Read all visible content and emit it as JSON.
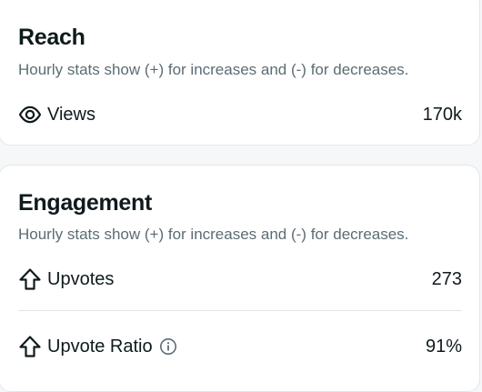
{
  "reach": {
    "title": "Reach",
    "subtitle": "Hourly stats show (+) for increases and (-) for decreases.",
    "views": {
      "icon": "eye-icon",
      "label": "Views",
      "value": "170k"
    }
  },
  "engagement": {
    "title": "Engagement",
    "subtitle": "Hourly stats show (+) for increases and (-) for decreases.",
    "upvotes": {
      "icon": "upvote-arrow-icon",
      "label": "Upvotes",
      "value": "273"
    },
    "upvote_ratio": {
      "icon": "upvote-arrow-icon",
      "label": "Upvote Ratio",
      "info_icon": "info-icon",
      "value": "91%"
    }
  },
  "colors": {
    "text_primary": "#0f1a1c",
    "text_secondary": "#5c6c74",
    "card_border": "#e3e6e8",
    "background": "#f6f7f8"
  }
}
